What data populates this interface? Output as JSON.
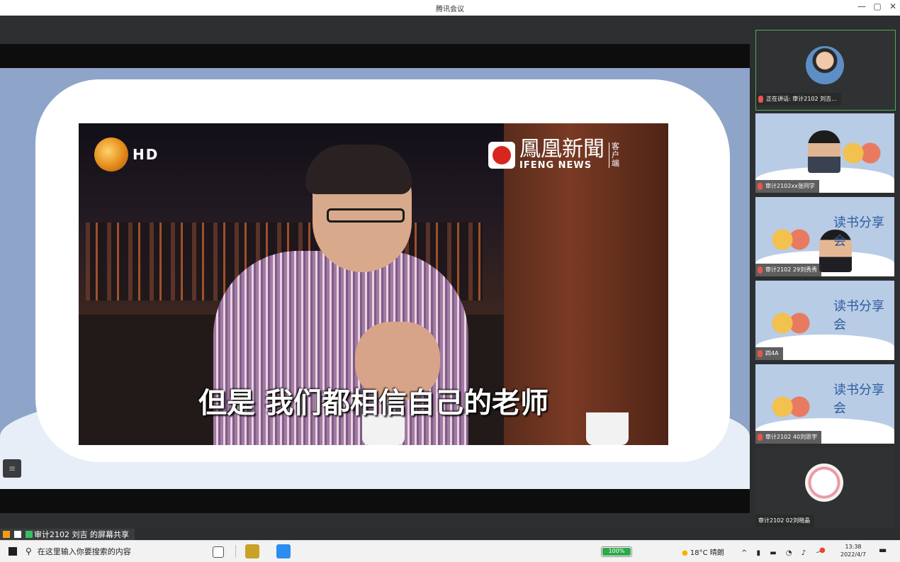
{
  "window": {
    "title": "腾讯会议"
  },
  "controls": {
    "minimize": "—",
    "maximize": "▢",
    "close": "✕"
  },
  "video": {
    "hd_badge": "HD",
    "channel_cn": "鳳凰新聞",
    "channel_en": "IFENG NEWS",
    "channel_client": "客户端",
    "subtitle": "但是 我们都相信自己的老师"
  },
  "participants": [
    {
      "name": "正在讲话: 审计2102 刘吉..."
    },
    {
      "name": "审计2102xx张同学"
    },
    {
      "name": "审计2102 29刘秀秀"
    },
    {
      "name": "四4A"
    },
    {
      "name": "审计2102 40刘思宇"
    },
    {
      "name": "审计2102 02刘晓晶"
    }
  ],
  "slide_text": {
    "line": "读书分享会"
  },
  "share_bar": {
    "text": "审计2102 刘吉 的屏幕共享"
  },
  "taskbar": {
    "search_placeholder": "在这里输入你要搜索的内容",
    "battery_pct": 100,
    "battery_label": "100%",
    "weather": "18°C 晴朗",
    "time": "13:38",
    "date": "2022/4/7"
  },
  "colors": {
    "accent": "#2ea84a",
    "slide_bg": "#8ea4c9",
    "mic": "#e4574c"
  }
}
